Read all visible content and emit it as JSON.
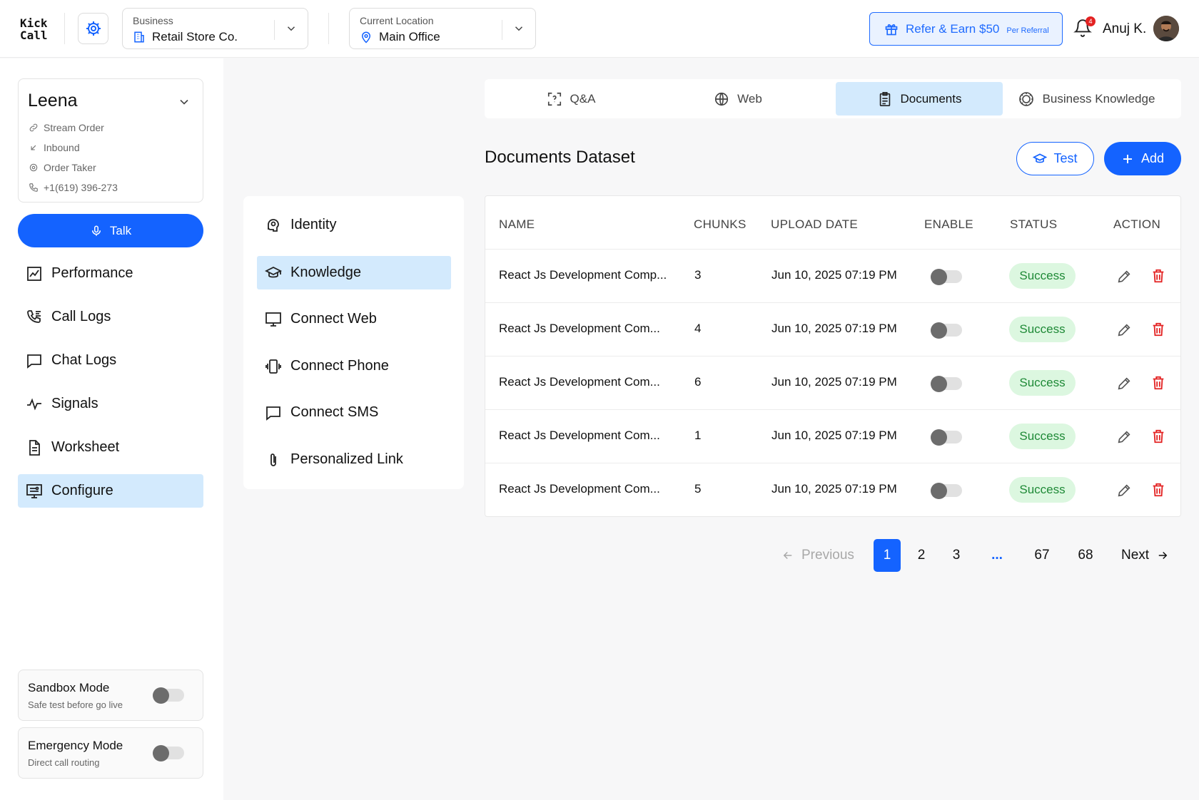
{
  "header": {
    "logo_line1": "Kick",
    "logo_line2": "Call",
    "business": {
      "label": "Business",
      "value": "Retail Store Co."
    },
    "location": {
      "label": "Current Location",
      "value": "Main Office"
    },
    "refer": {
      "main": "Refer & Earn $50",
      "sub": "Per Referral"
    },
    "notification_count": "4",
    "user_name": "Anuj K."
  },
  "agent": {
    "name": "Leena",
    "meta": [
      "Stream Order",
      "Inbound",
      "Order Taker",
      "+1(619) 396-273"
    ]
  },
  "talk_label": "Talk",
  "sidebar": {
    "items": [
      {
        "label": "Performance",
        "icon": "chart-icon",
        "active": false
      },
      {
        "label": "Call Logs",
        "icon": "phone-list-icon",
        "active": false
      },
      {
        "label": "Chat Logs",
        "icon": "chat-icon",
        "active": false
      },
      {
        "label": "Signals",
        "icon": "pulse-icon",
        "active": false
      },
      {
        "label": "Worksheet",
        "icon": "document-icon",
        "active": false
      },
      {
        "label": "Configure",
        "icon": "monitor-settings-icon",
        "active": true
      }
    ]
  },
  "modes": [
    {
      "title": "Sandbox Mode",
      "subtitle": "Safe test before go live",
      "enabled": false
    },
    {
      "title": "Emergency Mode",
      "subtitle": "Direct call routing",
      "enabled": false
    }
  ],
  "config_menu": {
    "items": [
      {
        "label": "Identity",
        "icon": "head-icon",
        "active": false
      },
      {
        "label": "Knowledge",
        "icon": "graduation-cap-icon",
        "active": true
      },
      {
        "label": "Connect Web",
        "icon": "monitor-icon",
        "active": false
      },
      {
        "label": "Connect Phone",
        "icon": "vibrating-phone-icon",
        "active": false
      },
      {
        "label": "Connect SMS",
        "icon": "message-square-icon",
        "active": false
      },
      {
        "label": "Personalized Link",
        "icon": "paperclip-icon",
        "active": false
      }
    ]
  },
  "tabs": [
    {
      "label": "Q&A",
      "icon": "scan-question-icon",
      "active": false
    },
    {
      "label": "Web",
      "icon": "globe-icon",
      "active": false
    },
    {
      "label": "Documents",
      "icon": "clipboard-icon",
      "active": true
    },
    {
      "label": "Business Knowledge",
      "icon": "gear-brain-icon",
      "active": false
    }
  ],
  "dataset": {
    "title": "Documents Dataset",
    "test_label": "Test",
    "add_label": "Add"
  },
  "table": {
    "columns": [
      "NAME",
      "CHUNKS",
      "UPLOAD DATE",
      "ENABLE",
      "STATUS",
      "ACTION"
    ],
    "rows": [
      {
        "name": "React Js Development Comp...",
        "chunks": "3",
        "date": "Jun 10, 2025 07:19 PM",
        "enabled": false,
        "status": "Success"
      },
      {
        "name": "React Js Development Com...",
        "chunks": "4",
        "date": "Jun 10, 2025 07:19 PM",
        "enabled": false,
        "status": "Success"
      },
      {
        "name": "React Js Development Com...",
        "chunks": "6",
        "date": "Jun 10, 2025 07:19 PM",
        "enabled": false,
        "status": "Success"
      },
      {
        "name": "React Js Development Com...",
        "chunks": "1",
        "date": "Jun 10, 2025 07:19 PM",
        "enabled": false,
        "status": "Success"
      },
      {
        "name": "React Js Development Com...",
        "chunks": "5",
        "date": "Jun 10, 2025 07:19 PM",
        "enabled": false,
        "status": "Success"
      }
    ]
  },
  "pagination": {
    "previous": "Previous",
    "next": "Next",
    "pages": [
      "1",
      "2",
      "3",
      "...",
      "67",
      "68"
    ],
    "current": "1"
  },
  "colors": {
    "accent": "#1463ff",
    "active_bg": "#d3eafd",
    "success_bg": "#dcf7e0",
    "success_text": "#1f8a37",
    "danger": "#e32222"
  }
}
